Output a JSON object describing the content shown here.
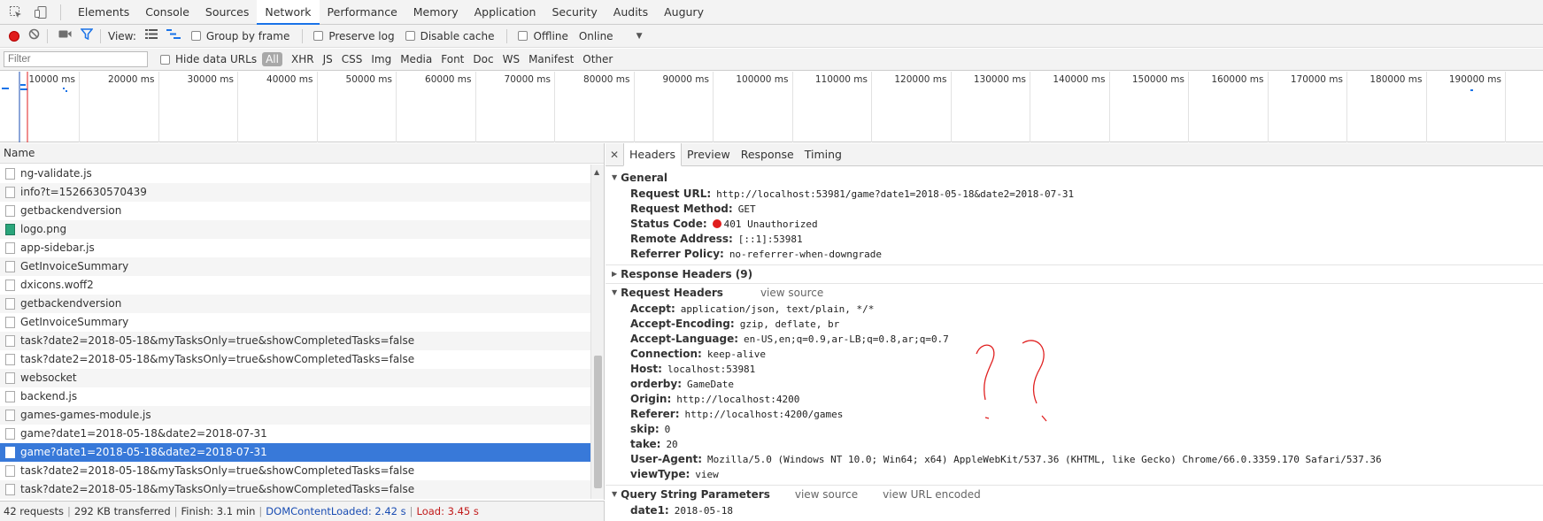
{
  "tabs": [
    "Elements",
    "Console",
    "Sources",
    "Network",
    "Performance",
    "Memory",
    "Application",
    "Security",
    "Audits",
    "Augury"
  ],
  "active_tab": "Network",
  "toolbar": {
    "view_label": "View:",
    "group_by_frame": "Group by frame",
    "preserve_log": "Preserve log",
    "disable_cache": "Disable cache",
    "offline": "Offline",
    "throttle": "Online"
  },
  "filter": {
    "placeholder": "Filter",
    "hide_data_urls": "Hide data URLs",
    "types": [
      "All",
      "XHR",
      "JS",
      "CSS",
      "Img",
      "Media",
      "Font",
      "Doc",
      "WS",
      "Manifest",
      "Other"
    ]
  },
  "timeline_ticks": [
    "10000 ms",
    "20000 ms",
    "30000 ms",
    "40000 ms",
    "50000 ms",
    "60000 ms",
    "70000 ms",
    "80000 ms",
    "90000 ms",
    "100000 ms",
    "110000 ms",
    "120000 ms",
    "130000 ms",
    "140000 ms",
    "150000 ms",
    "160000 ms",
    "170000 ms",
    "180000 ms",
    "190000 ms"
  ],
  "list": {
    "header": "Name",
    "rows": [
      {
        "name": "ng-validate.js",
        "type": "file"
      },
      {
        "name": "info?t=1526630570439",
        "type": "file"
      },
      {
        "name": "getbackendversion",
        "type": "file"
      },
      {
        "name": "logo.png",
        "type": "img"
      },
      {
        "name": "app-sidebar.js",
        "type": "file"
      },
      {
        "name": "GetInvoiceSummary",
        "type": "file"
      },
      {
        "name": "dxicons.woff2",
        "type": "file"
      },
      {
        "name": "getbackendversion",
        "type": "file"
      },
      {
        "name": "GetInvoiceSummary",
        "type": "file"
      },
      {
        "name": "task?date2=2018-05-18&myTasksOnly=true&showCompletedTasks=false",
        "type": "file"
      },
      {
        "name": "task?date2=2018-05-18&myTasksOnly=true&showCompletedTasks=false",
        "type": "file"
      },
      {
        "name": "websocket",
        "type": "file"
      },
      {
        "name": "backend.js",
        "type": "file"
      },
      {
        "name": "games-games-module.js",
        "type": "file"
      },
      {
        "name": "game?date1=2018-05-18&date2=2018-07-31",
        "type": "file"
      },
      {
        "name": "game?date1=2018-05-18&date2=2018-07-31",
        "type": "file",
        "selected": true
      },
      {
        "name": "task?date2=2018-05-18&myTasksOnly=true&showCompletedTasks=false",
        "type": "file"
      },
      {
        "name": "task?date2=2018-05-18&myTasksOnly=true&showCompletedTasks=false",
        "type": "file"
      }
    ]
  },
  "status": {
    "requests": "42 requests",
    "transferred": "292 KB transferred",
    "finish": "Finish: 3.1 min",
    "dom_content_loaded": "DOMContentLoaded: 2.42 s",
    "load": "Load: 3.45 s"
  },
  "details": {
    "tabs": [
      "Headers",
      "Preview",
      "Response",
      "Timing"
    ],
    "active_tab": "Headers",
    "general": {
      "title": "General",
      "items": [
        {
          "k": "Request URL:",
          "v": "http://localhost:53981/game?date1=2018-05-18&date2=2018-07-31"
        },
        {
          "k": "Request Method:",
          "v": "GET"
        },
        {
          "k": "Status Code:",
          "v": "401 Unauthorized"
        },
        {
          "k": "Remote Address:",
          "v": "[::1]:53981"
        },
        {
          "k": "Referrer Policy:",
          "v": "no-referrer-when-downgrade"
        }
      ]
    },
    "response_headers": {
      "title": "Response Headers (9)"
    },
    "request_headers": {
      "title": "Request Headers",
      "view_source": "view source",
      "items": [
        {
          "k": "Accept:",
          "v": "application/json, text/plain, */*"
        },
        {
          "k": "Accept-Encoding:",
          "v": "gzip, deflate, br"
        },
        {
          "k": "Accept-Language:",
          "v": "en-US,en;q=0.9,ar-LB;q=0.8,ar;q=0.7"
        },
        {
          "k": "Connection:",
          "v": "keep-alive"
        },
        {
          "k": "Host:",
          "v": "localhost:53981"
        },
        {
          "k": "orderby:",
          "v": "GameDate"
        },
        {
          "k": "Origin:",
          "v": "http://localhost:4200"
        },
        {
          "k": "Referer:",
          "v": "http://localhost:4200/games"
        },
        {
          "k": "skip:",
          "v": "0"
        },
        {
          "k": "take:",
          "v": "20"
        },
        {
          "k": "User-Agent:",
          "v": "Mozilla/5.0 (Windows NT 10.0; Win64; x64) AppleWebKit/537.36 (KHTML, like Gecko) Chrome/66.0.3359.170 Safari/537.36"
        },
        {
          "k": "viewType:",
          "v": "view"
        }
      ]
    },
    "query_string": {
      "title": "Query String Parameters",
      "view_source": "view source",
      "view_url_encoded": "view URL encoded",
      "items": [
        {
          "k": "date1:",
          "v": "2018-05-18"
        }
      ]
    }
  },
  "colors": {
    "accent": "#1a73e8",
    "selected_row": "#3879d9",
    "record": "#e01d1d",
    "scribble": "#e02020"
  }
}
